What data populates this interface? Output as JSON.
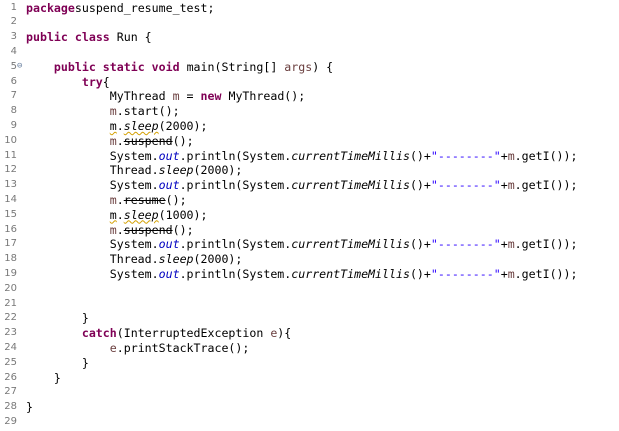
{
  "editor": {
    "lines": [
      {
        "n": "1",
        "t": [
          [
            "kw",
            "package"
          ],
          [
            "",
            "suspend_resume_test;"
          ]
        ]
      },
      {
        "n": "2",
        "t": []
      },
      {
        "n": "3",
        "t": [
          [
            "kw",
            "public"
          ],
          [
            "",
            " "
          ],
          [
            "kw",
            "class"
          ],
          [
            "",
            " Run {"
          ]
        ]
      },
      {
        "n": "4",
        "t": []
      },
      {
        "n": "5",
        "fold": true,
        "t": [
          [
            "",
            "    "
          ],
          [
            "kw",
            "public"
          ],
          [
            "",
            " "
          ],
          [
            "kw",
            "static"
          ],
          [
            "",
            " "
          ],
          [
            "kw",
            "void"
          ],
          [
            "",
            " main(String[] "
          ],
          [
            "param",
            "args"
          ],
          [
            "",
            ") {"
          ]
        ]
      },
      {
        "n": "6",
        "t": [
          [
            "",
            "        "
          ],
          [
            "kw",
            "try"
          ],
          [
            "",
            "{"
          ]
        ]
      },
      {
        "n": "7",
        "t": [
          [
            "",
            "            MyThread "
          ],
          [
            "param",
            "m"
          ],
          [
            "",
            " = "
          ],
          [
            "kw",
            "new"
          ],
          [
            "",
            " MyThread();"
          ]
        ]
      },
      {
        "n": "8",
        "t": [
          [
            "",
            "            "
          ],
          [
            "param",
            "m"
          ],
          [
            "",
            ".start();"
          ]
        ]
      },
      {
        "n": "9",
        "t": [
          [
            "",
            "            "
          ],
          [
            "warn",
            "m"
          ],
          [
            "",
            "."
          ],
          [
            "warn static",
            "sleep"
          ],
          [
            "",
            "(2000);"
          ]
        ]
      },
      {
        "n": "10",
        "t": [
          [
            "",
            "            "
          ],
          [
            "param",
            "m"
          ],
          [
            "",
            "."
          ],
          [
            "strike warn",
            "suspend"
          ],
          [
            "",
            "();"
          ]
        ]
      },
      {
        "n": "11",
        "t": [
          [
            "",
            "            System."
          ],
          [
            "field",
            "out"
          ],
          [
            "",
            ".println(System."
          ],
          [
            "static",
            "currentTimeMillis"
          ],
          [
            "",
            "()+"
          ],
          [
            "str",
            "\"--------\""
          ],
          [
            "",
            "+"
          ],
          [
            "param",
            "m"
          ],
          [
            "",
            ".getI());"
          ]
        ]
      },
      {
        "n": "12",
        "t": [
          [
            "",
            "            Thread."
          ],
          [
            "static",
            "sleep"
          ],
          [
            "",
            "(2000);"
          ]
        ]
      },
      {
        "n": "13",
        "t": [
          [
            "",
            "            System."
          ],
          [
            "field",
            "out"
          ],
          [
            "",
            ".println(System."
          ],
          [
            "static",
            "currentTimeMillis"
          ],
          [
            "",
            "()+"
          ],
          [
            "str",
            "\"--------\""
          ],
          [
            "",
            "+"
          ],
          [
            "param",
            "m"
          ],
          [
            "",
            ".getI());"
          ]
        ]
      },
      {
        "n": "14",
        "t": [
          [
            "",
            "            "
          ],
          [
            "param",
            "m"
          ],
          [
            "",
            "."
          ],
          [
            "strike warn",
            "resume"
          ],
          [
            "",
            "();"
          ]
        ]
      },
      {
        "n": "15",
        "t": [
          [
            "",
            "            "
          ],
          [
            "warn",
            "m"
          ],
          [
            "",
            "."
          ],
          [
            "warn static",
            "sleep"
          ],
          [
            "",
            "(1000);"
          ]
        ]
      },
      {
        "n": "16",
        "t": [
          [
            "",
            "            "
          ],
          [
            "param",
            "m"
          ],
          [
            "",
            "."
          ],
          [
            "strike warn",
            "suspend"
          ],
          [
            "",
            "();"
          ]
        ]
      },
      {
        "n": "17",
        "t": [
          [
            "",
            "            System."
          ],
          [
            "field",
            "out"
          ],
          [
            "",
            ".println(System."
          ],
          [
            "static",
            "currentTimeMillis"
          ],
          [
            "",
            "()+"
          ],
          [
            "str",
            "\"--------\""
          ],
          [
            "",
            "+"
          ],
          [
            "param",
            "m"
          ],
          [
            "",
            ".getI());"
          ]
        ]
      },
      {
        "n": "18",
        "t": [
          [
            "",
            "            Thread."
          ],
          [
            "static",
            "sleep"
          ],
          [
            "",
            "(2000);"
          ]
        ]
      },
      {
        "n": "19",
        "t": [
          [
            "",
            "            System."
          ],
          [
            "field",
            "out"
          ],
          [
            "",
            ".println(System."
          ],
          [
            "static",
            "currentTimeMillis"
          ],
          [
            "",
            "()+"
          ],
          [
            "str",
            "\"--------\""
          ],
          [
            "",
            "+"
          ],
          [
            "param",
            "m"
          ],
          [
            "",
            ".getI());"
          ]
        ]
      },
      {
        "n": "20",
        "t": []
      },
      {
        "n": "21",
        "t": []
      },
      {
        "n": "22",
        "t": [
          [
            "",
            "        }"
          ]
        ]
      },
      {
        "n": "23",
        "t": [
          [
            "",
            "        "
          ],
          [
            "kw",
            "catch"
          ],
          [
            "",
            "(InterruptedException "
          ],
          [
            "param",
            "e"
          ],
          [
            "",
            "){"
          ]
        ]
      },
      {
        "n": "24",
        "t": [
          [
            "",
            "            "
          ],
          [
            "param",
            "e"
          ],
          [
            "",
            ".printStackTrace();"
          ]
        ]
      },
      {
        "n": "25",
        "t": [
          [
            "",
            "        }"
          ]
        ]
      },
      {
        "n": "26",
        "t": [
          [
            "",
            "    }"
          ]
        ]
      },
      {
        "n": "27",
        "t": []
      },
      {
        "n": "28",
        "t": [
          [
            "",
            "}"
          ]
        ]
      },
      {
        "n": "29",
        "t": []
      }
    ]
  }
}
